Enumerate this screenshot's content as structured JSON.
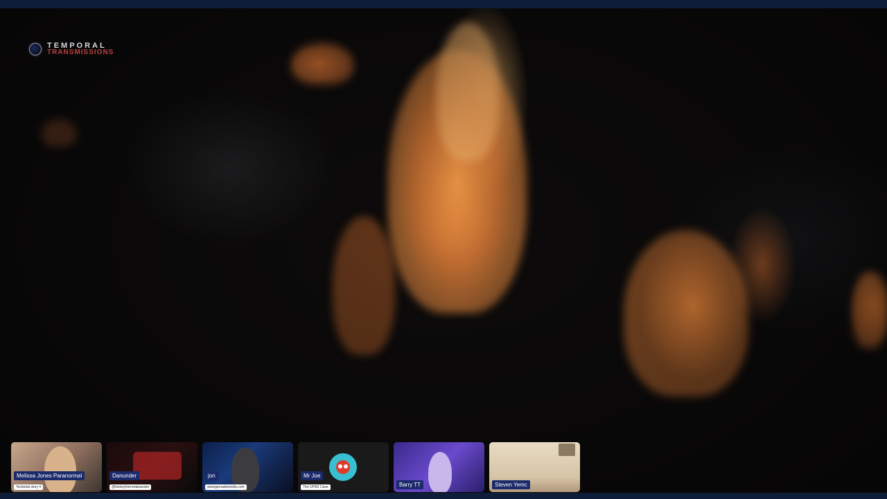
{
  "branding": {
    "logo_line1": "TEMPORAL",
    "logo_line2": "TRANSMISSIONS"
  },
  "participants": [
    {
      "name": "Melissa Jones Paranormal",
      "subtitle": "Tecbridal story #"
    },
    {
      "name": "Danunder",
      "subtitle": "@historyhorrordanunder"
    },
    {
      "name": "jon",
      "subtitle": "strangeroadsmedia.com"
    },
    {
      "name": "Mr Joe",
      "subtitle": "The UFNX Cave"
    },
    {
      "name": "Barry TT"
    },
    {
      "name": "Steven Yemc"
    }
  ],
  "colors": {
    "top_bar": "#0e1e38",
    "nametag_bg": "#1a2a6a",
    "flame": "#f08a3c"
  }
}
